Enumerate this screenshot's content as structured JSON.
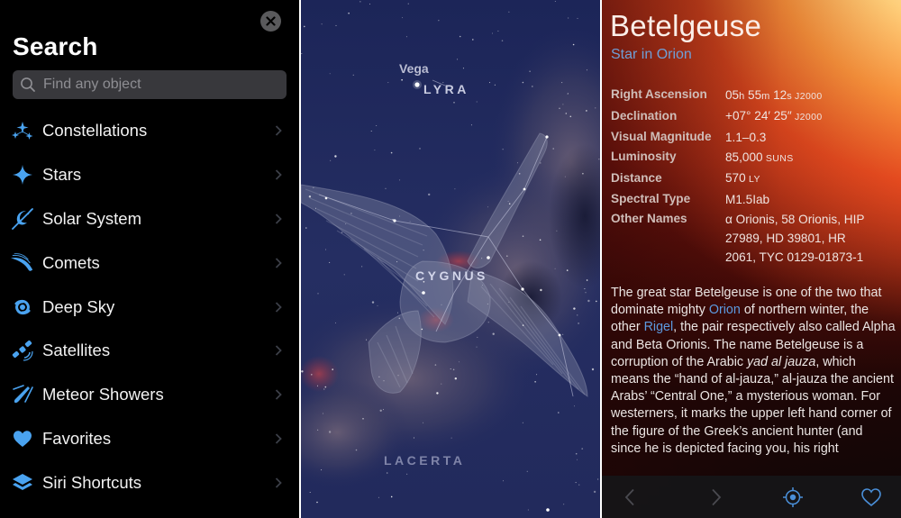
{
  "search_panel": {
    "title": "Search",
    "close_icon": "close-icon",
    "search": {
      "placeholder": "Find any object",
      "value": ""
    },
    "accent_color": "#4aa3f0",
    "items": [
      {
        "label": "Constellations",
        "icon": "constellations-icon"
      },
      {
        "label": "Stars",
        "icon": "star-icon"
      },
      {
        "label": "Solar System",
        "icon": "planet-icon"
      },
      {
        "label": "Comets",
        "icon": "comet-icon"
      },
      {
        "label": "Deep Sky",
        "icon": "galaxy-icon"
      },
      {
        "label": "Satellites",
        "icon": "satellite-icon"
      },
      {
        "label": "Meteor Showers",
        "icon": "meteor-icon"
      },
      {
        "label": "Favorites",
        "icon": "heart-icon"
      },
      {
        "label": "Siri Shortcuts",
        "icon": "layers-icon"
      }
    ]
  },
  "sky_panel": {
    "star_labels": [
      {
        "name": "Vega"
      }
    ],
    "constellation_labels": [
      {
        "name": "LYRA"
      },
      {
        "name": "CYGNUS"
      },
      {
        "name": "LACERTA"
      }
    ]
  },
  "detail_panel": {
    "name": "Betelgeuse",
    "subtitle": "Star in Orion",
    "properties": {
      "right_ascension": {
        "label": "Right Ascension",
        "h": "05",
        "h_unit": "h",
        "m": " 55",
        "m_unit": "m",
        "s": " 12",
        "s_unit": "s",
        "epoch": " J2000"
      },
      "declination": {
        "label": "Declination",
        "value": "+07° 24′ 25″",
        "epoch": " J2000"
      },
      "visual_magnitude": {
        "label": "Visual Magnitude",
        "value": "1.1–0.3"
      },
      "luminosity": {
        "label": "Luminosity",
        "value": "85,000",
        "unit": " SUNS"
      },
      "distance": {
        "label": "Distance",
        "value": "570",
        "unit": " LY"
      },
      "spectral_type": {
        "label": "Spectral Type",
        "value": "M1.5Iab"
      },
      "other_names": {
        "label": "Other Names",
        "value": "α Orionis, 58 Orionis, HIP 27989, HD 39801, HR 2061, TYC 0129-01873-1"
      }
    },
    "description": {
      "p1": "The great star Betelgeuse is one of the two that dominate mighty ",
      "link1": "Orion",
      "p2": " of northern winter, the other ",
      "link2": "Rigel",
      "p3": ", the pair respectively also called Alpha and Beta Orionis. The name Betelgeuse is a corruption of the Arabic ",
      "em1": "yad al jauza",
      "p4": ", which means the “hand of al-jauza,” al-jauza the ancient Arabs’ “Central One,” a mysterious woman. For westerners, it marks the upper left hand corner of the figure of the Greek’s ancient hunter (and since he is depicted facing you, his right"
    },
    "toolbar": {
      "back_icon": "chevron-left-icon",
      "forward_icon": "chevron-right-icon",
      "locate_icon": "locate-icon",
      "favorite_icon": "heart-outline-icon"
    },
    "link_color": "#5c9ae0"
  }
}
